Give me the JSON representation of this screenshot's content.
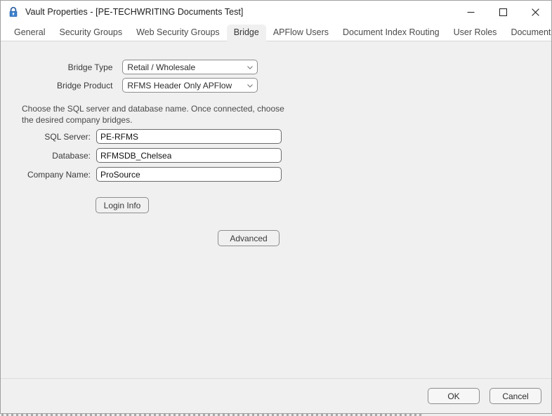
{
  "window": {
    "title": "Vault Properties - [PE-TECHWRITING Documents Test]",
    "icon": "lock-icon",
    "controls": {
      "minimize": "Minimize",
      "maximize": "Maximize",
      "close": "Close"
    }
  },
  "tabs": [
    {
      "label": "General",
      "active": false
    },
    {
      "label": "Security Groups",
      "active": false
    },
    {
      "label": "Web Security Groups",
      "active": false
    },
    {
      "label": "Bridge",
      "active": true
    },
    {
      "label": "APFlow Users",
      "active": false
    },
    {
      "label": "Document Index Routing",
      "active": false
    },
    {
      "label": "User Roles",
      "active": false
    },
    {
      "label": "Document Publishing",
      "active": false
    }
  ],
  "bridge_panel": {
    "bridge_type": {
      "label": "Bridge Type",
      "value": "Retail / Wholesale",
      "icon": "chevron-down-icon"
    },
    "bridge_product": {
      "label": "Bridge Product",
      "value": "RFMS Header Only APFlow",
      "icon": "chevron-down-icon"
    },
    "help_text": "Choose the SQL server and database name.  Once connected, choose the desired company bridges.",
    "sql_server": {
      "label": "SQL Server:",
      "value": "PE-RFMS",
      "placeholder": ""
    },
    "database": {
      "label": "Database:",
      "value": "RFMSDB_Chelsea",
      "placeholder": ""
    },
    "company_name": {
      "label": "Company Name:",
      "value": "ProSource",
      "placeholder": ""
    },
    "login_info_button": "Login Info",
    "advanced_button": "Advanced"
  },
  "footer": {
    "ok_button": "OK",
    "cancel_button": "Cancel"
  },
  "colors": {
    "window_background": "#f0f0f0",
    "titlebar_background": "#ffffff",
    "accent_lock": "#2a5d9e",
    "text_primary": "#1b1b1b",
    "text_label": "#3a3a3a",
    "border": "#8d8d8d"
  }
}
